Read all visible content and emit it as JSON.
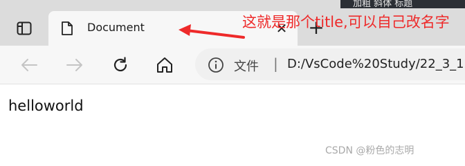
{
  "side_strip": {
    "text": "加粗 斜体 标题"
  },
  "tab": {
    "title": "Document",
    "close_glyph": "✕"
  },
  "new_tab_glyph": "+",
  "address_bar": {
    "security_label": "文件",
    "separator": "|",
    "url": "D:/VsCode%20Study/22_3_1"
  },
  "page": {
    "body_text": "helloworld"
  },
  "annotation": {
    "text": "这就是那个title,可以自己改名字"
  },
  "watermark": "CSDN @粉色的志明",
  "colors": {
    "annotation": "#ee2a2a",
    "tabstrip": "#dcdcdc",
    "toolbar": "#f7f7f7"
  }
}
